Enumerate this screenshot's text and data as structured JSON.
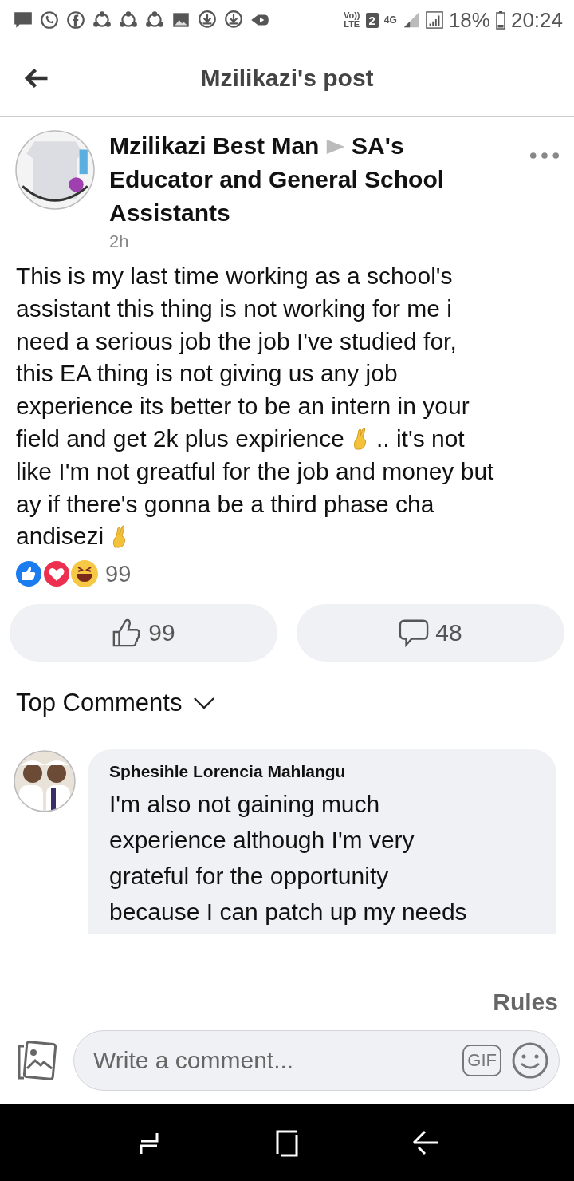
{
  "status_bar": {
    "network": "Vo))\nLTE",
    "sim": "2",
    "data": "4G",
    "battery": "18%",
    "time": "20:24"
  },
  "app_bar": {
    "title": "Mzilikazi's post"
  },
  "post": {
    "author": "Mzilikazi Best Man",
    "group": "SA's Educator and General School Assistants",
    "time": "2h",
    "body_lines": [
      [
        {
          "kind": "text",
          "text": "This is my last time working as a school's"
        }
      ],
      [
        {
          "kind": "text",
          "text": "assistant this thing is not working for me i"
        }
      ],
      [
        {
          "kind": "text",
          "text": "need a serious job the job I've studied for,"
        }
      ],
      [
        {
          "kind": "text",
          "text": "this EA thing is not giving us any job"
        }
      ],
      [
        {
          "kind": "text",
          "text": "experience its better to be an intern in your"
        }
      ],
      [
        {
          "kind": "text",
          "text": "field and get 2k plus expirience"
        },
        {
          "kind": "emoji"
        },
        {
          "kind": "text",
          "text": ".. it's not"
        }
      ],
      [
        {
          "kind": "text",
          "text": "like I'm not greatful for the job and money but"
        }
      ],
      [
        {
          "kind": "text",
          "text": "ay if there's gonna be a third phase cha"
        }
      ],
      [
        {
          "kind": "text",
          "text": "andisezi"
        },
        {
          "kind": "emoji"
        }
      ]
    ],
    "reaction_count": "99",
    "like_count": "99",
    "comment_count": "48"
  },
  "comments_header": {
    "label": "Top Comments"
  },
  "comments": [
    {
      "author": "Sphesihle Lorencia Mahlangu",
      "text": "I'm also not gaining much experience although I'm very grateful for the opportunity because I can patch up my needs"
    }
  ],
  "rules_link": "Rules",
  "composer": {
    "placeholder": "Write a comment...",
    "gif": "GIF"
  }
}
